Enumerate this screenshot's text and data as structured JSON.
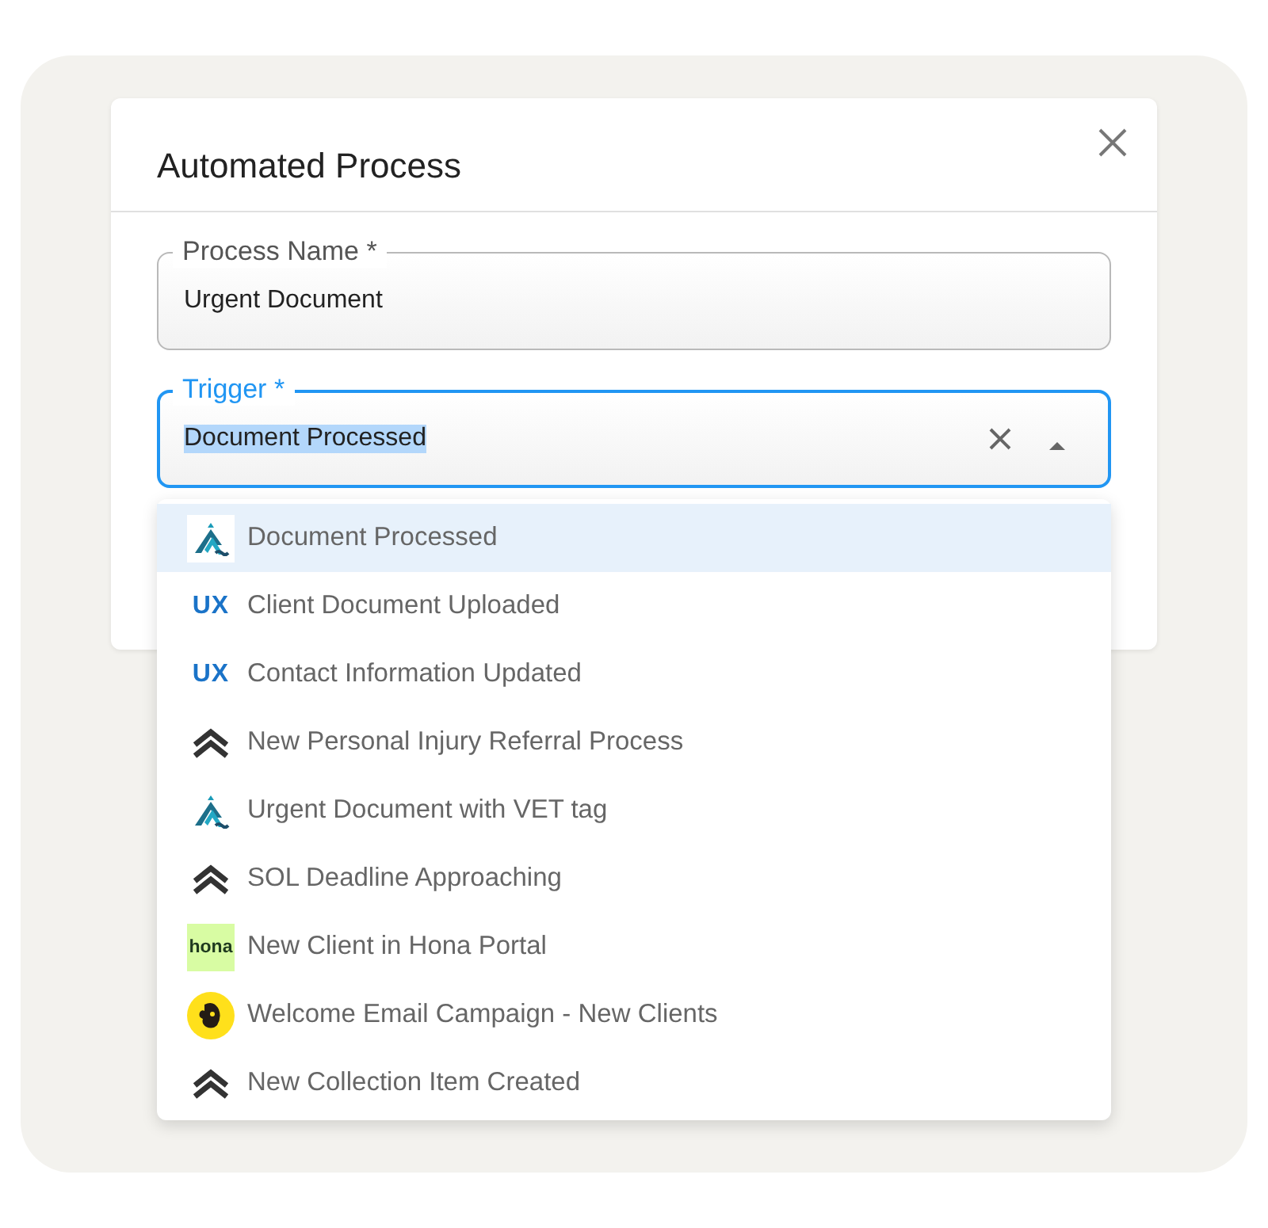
{
  "dialog": {
    "title": "Automated Process"
  },
  "fields": [
    {
      "label": "Process Name *",
      "value": "Urgent Document",
      "focused": false
    },
    {
      "label": "Trigger *",
      "value": "Document Processed",
      "focused": true,
      "kind": "select",
      "expanded": true
    }
  ],
  "options": [
    {
      "label": "Document Processed",
      "kind": "peaks",
      "selected": true
    },
    {
      "label": "Client Document Uploaded",
      "kind": "ux",
      "logo_text": "UX",
      "selected": false
    },
    {
      "label": "Contact Information Updated",
      "kind": "ux",
      "logo_text": "UX",
      "selected": false
    },
    {
      "label": "New Personal Injury Referral Process",
      "kind": "chevrons",
      "selected": false
    },
    {
      "label": "Urgent Document with VET tag",
      "kind": "peaks",
      "selected": false
    },
    {
      "label": "SOL Deadline Approaching",
      "kind": "chevrons",
      "selected": false
    },
    {
      "label": "New Client in Hona Portal",
      "kind": "hona",
      "logo_text": "hona",
      "selected": false
    },
    {
      "label": "Welcome Email Campaign - New Clients",
      "kind": "mascot",
      "selected": false
    },
    {
      "label": "New Collection Item Created",
      "kind": "chevrons",
      "selected": false
    }
  ]
}
